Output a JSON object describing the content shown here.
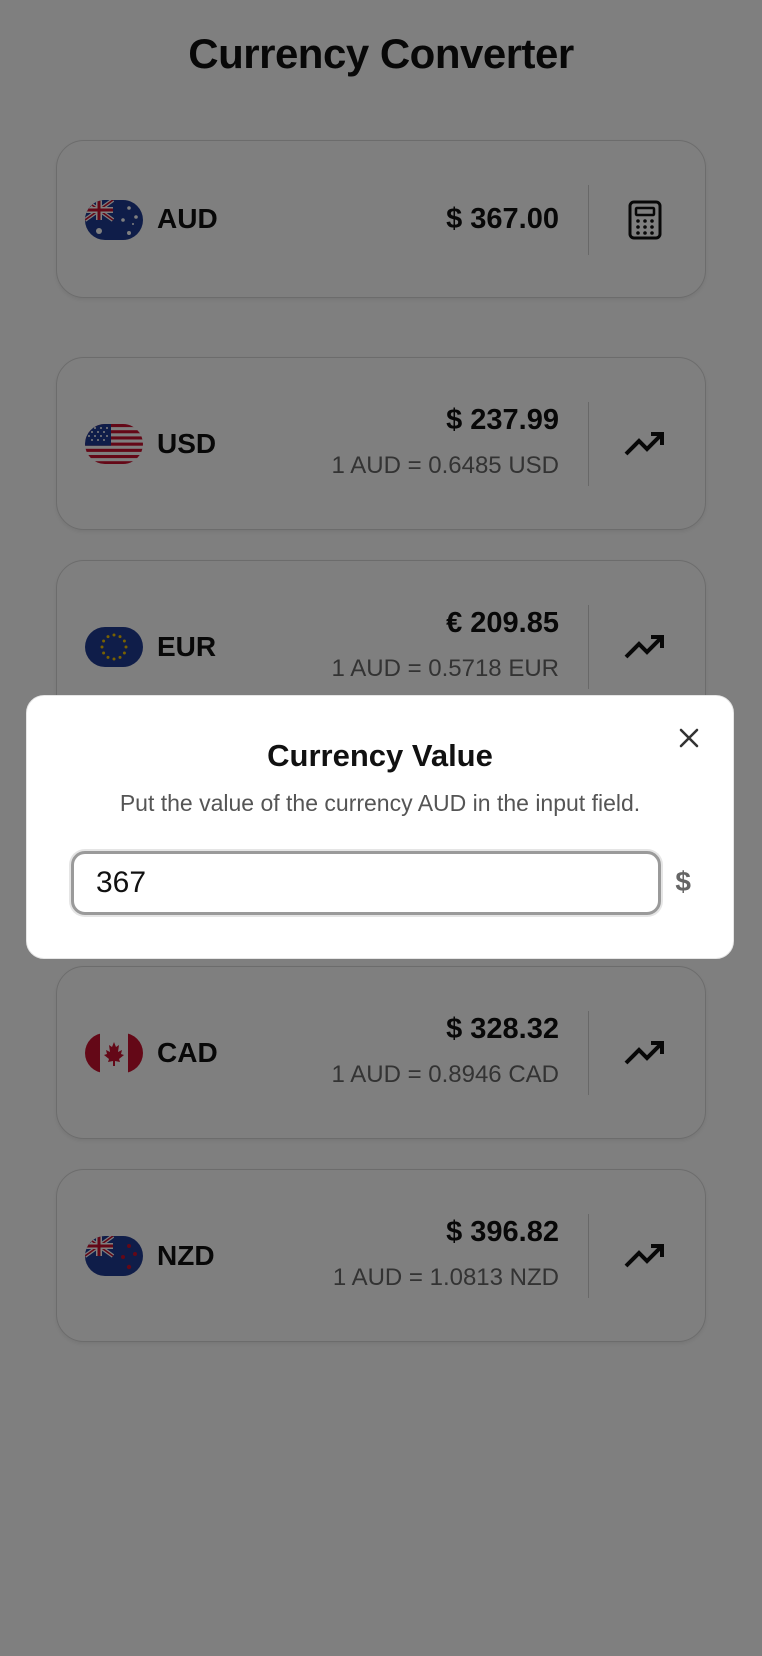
{
  "app": {
    "title": "Currency Converter"
  },
  "base": {
    "code": "AUD",
    "amount": "$ 367.00",
    "flag_icon": "australia-flag-icon",
    "action_icon": "calculator-icon"
  },
  "currencies": [
    {
      "code": "USD",
      "amount": "$ 237.99",
      "rate": "1 AUD = 0.6485 USD",
      "flag_icon": "usa-flag-icon",
      "action_icon": "trending-up-icon"
    },
    {
      "code": "EUR",
      "amount": "€ 209.85",
      "rate": "1 AUD = 0.5718 EUR",
      "flag_icon": "eu-flag-icon",
      "action_icon": "trending-up-icon"
    },
    {
      "code": "CAD",
      "amount": "$ 328.32",
      "rate": "1 AUD = 0.8946 CAD",
      "flag_icon": "canada-flag-icon",
      "action_icon": "trending-up-icon"
    },
    {
      "code": "NZD",
      "amount": "$ 396.82",
      "rate": "1 AUD = 1.0813 NZD",
      "flag_icon": "new-zealand-flag-icon",
      "action_icon": "trending-up-icon"
    }
  ],
  "modal": {
    "title": "Currency Value",
    "description": "Put the value of the currency AUD in the input field.",
    "input_value": "367",
    "currency_symbol": "$",
    "close_icon": "close-icon"
  },
  "colors": {
    "overlay": "rgba(0,0,0,0.5)",
    "flag_blue": "#1f3a93",
    "flag_red": "#c8102e"
  }
}
